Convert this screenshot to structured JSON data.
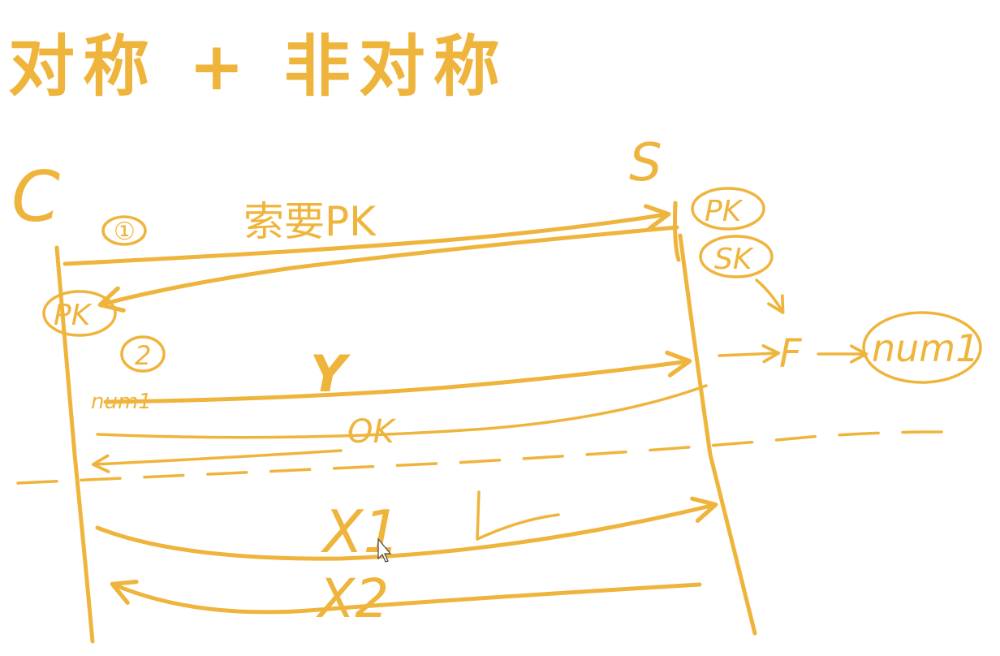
{
  "title": "对称 + 非对称",
  "diagram": {
    "ink_color": "#EFB43C",
    "nodes": {
      "client": "C",
      "server": "S"
    },
    "steps": {
      "step1": "①",
      "step2": "2"
    },
    "messages": {
      "request_pk": "索要PK",
      "encrypted_r": "Y",
      "ok": "OK",
      "x1": "X1",
      "x2": "X2"
    },
    "server_keys": {
      "public_key": "PK",
      "secret_key": "SK"
    },
    "client_key": "PK",
    "client_secret": "num1",
    "server_flow": {
      "f_label": "F",
      "result": "num1"
    }
  }
}
